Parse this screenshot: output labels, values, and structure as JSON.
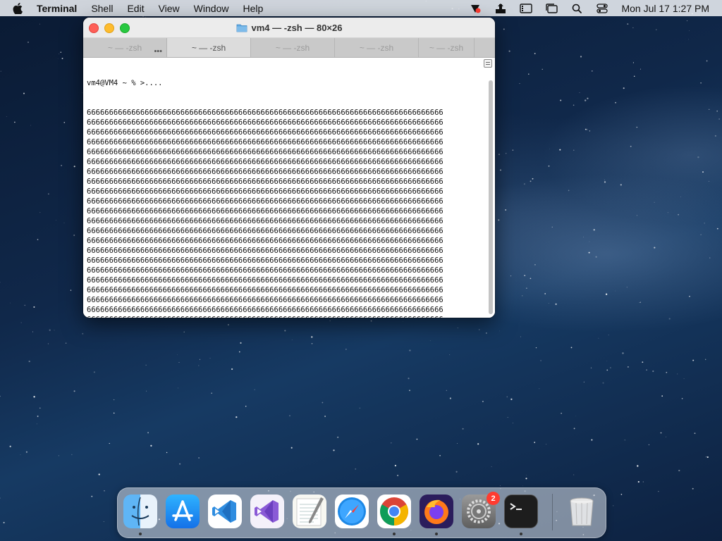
{
  "menubar": {
    "items": [
      "Terminal",
      "Shell",
      "Edit",
      "View",
      "Window",
      "Help"
    ],
    "clock": "Mon Jul 17  1:27 PM"
  },
  "window": {
    "title": "vm4 — -zsh — 80×26",
    "tabs": [
      "~ — -zsh",
      "~ — -zsh",
      "~ — -zsh",
      "~ — -zsh",
      "~ — -zsh"
    ],
    "active_tab_index": 1,
    "prompt": "vm4@VM4 ~ % >....",
    "full_line": "66666666666666666666666666666666666666666666666666666666666666666666666666666666",
    "last_line": "666666666666666666666666666666666666666666666666",
    "full_line_count": 24
  },
  "dock": {
    "items": [
      {
        "name": "Finder",
        "running": true
      },
      {
        "name": "App Store",
        "running": false
      },
      {
        "name": "Visual Studio Code",
        "running": false
      },
      {
        "name": "Visual Studio",
        "running": false
      },
      {
        "name": "TextEdit",
        "running": false
      },
      {
        "name": "Safari",
        "running": false
      },
      {
        "name": "Google Chrome",
        "running": true
      },
      {
        "name": "Firefox",
        "running": true
      },
      {
        "name": "System Preferences",
        "running": false,
        "badge": "2"
      },
      {
        "name": "Terminal",
        "running": true
      },
      {
        "name": "Trash",
        "running": false
      }
    ]
  },
  "colors": {
    "accent_red": "#ff3b30",
    "terminal_text": "#111111",
    "close": "#fe5f57",
    "minimize": "#febc2e",
    "zoom": "#28c840"
  }
}
